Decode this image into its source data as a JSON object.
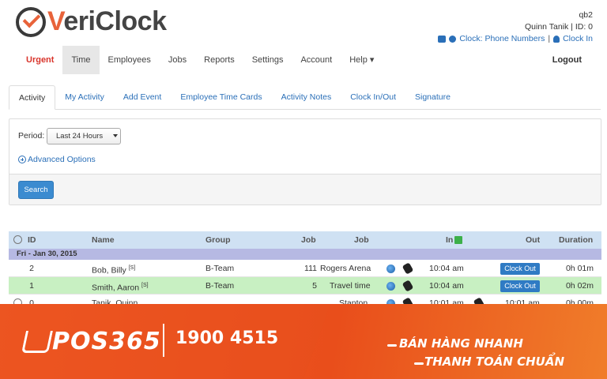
{
  "app": {
    "brand": {
      "prefix": "V",
      "rest": "eriClock"
    },
    "user": {
      "login": "qb2",
      "name_id": "Quinn Tanik | ID: 0"
    },
    "links": {
      "clock": "Clock: Phone Numbers",
      "separator": "|",
      "clock_in": "Clock In"
    }
  },
  "nav": {
    "items": [
      "Urgent",
      "Time",
      "Employees",
      "Jobs",
      "Reports",
      "Settings",
      "Account",
      "Help ▾"
    ],
    "active": "Time",
    "logout": "Logout"
  },
  "tabs": [
    "Activity",
    "My Activity",
    "Add Event",
    "Employee Time Cards",
    "Activity Notes",
    "Clock In/Out",
    "Signature"
  ],
  "filter": {
    "period_label": "Period:",
    "period_value": "Last 24 Hours",
    "advanced": "Advanced Options",
    "search": "Search"
  },
  "table": {
    "headers": {
      "id": "ID",
      "name": "Name",
      "group": "Group",
      "job_num": "Job",
      "job": "Job",
      "in": "In",
      "out": "Out",
      "duration": "Duration"
    },
    "date_label": "Fri - Jan 30, 2015",
    "rows": [
      {
        "id": "2",
        "name": "Bob, Billy",
        "badge": "[S]",
        "group": "B-Team",
        "job_num": "111",
        "job": "Rogers Arena",
        "in": "10:04 am",
        "out_button": "Clock Out",
        "out": "",
        "duration": "0h 01m",
        "highlight": false
      },
      {
        "id": "1",
        "name": "Smith, Aaron",
        "badge": "[S]",
        "group": "B-Team",
        "job_num": "5",
        "job": "Travel time",
        "in": "10:04 am",
        "out_button": "Clock Out",
        "out": "",
        "duration": "0h 02m",
        "highlight": true
      },
      {
        "id": "0",
        "name": "Tanik, Quinn",
        "badge": "",
        "group": "",
        "job_num": "",
        "job": "Stanton",
        "in": "10:01 am",
        "out_button": "",
        "out": "10:01 am",
        "duration": "0h 00m",
        "highlight": false
      }
    ]
  },
  "banner": {
    "logo": "POS365",
    "phone": "1900 4515",
    "slogan1": "BÁN HÀNG NHANH",
    "slogan2": "THANH TOÁN CHUẨN",
    "color": "#f15a24"
  }
}
